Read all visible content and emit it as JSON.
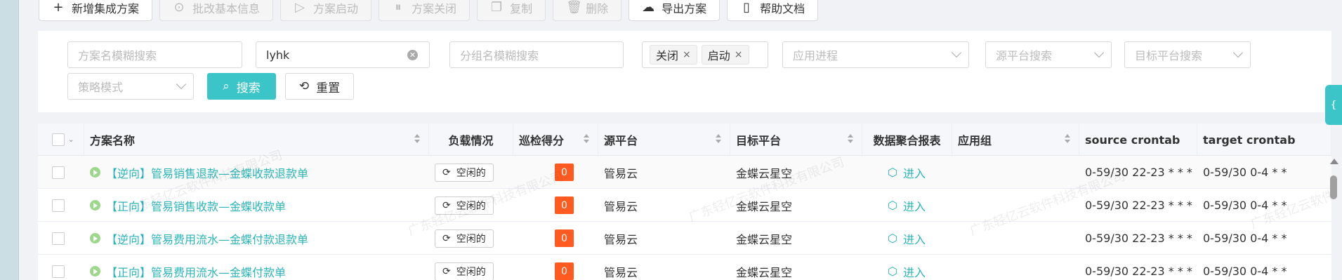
{
  "toolbar": {
    "buttons": [
      {
        "label": "新增集成方案",
        "icon": "plus-icon",
        "disabled": false
      },
      {
        "label": "批改基本信息",
        "icon": "check-circle-icon",
        "disabled": true
      },
      {
        "label": "方案启动",
        "icon": "play-circle-icon",
        "disabled": true
      },
      {
        "label": "方案关闭",
        "icon": "pause-circle-icon",
        "disabled": true
      },
      {
        "label": "复制",
        "icon": "copy-icon",
        "disabled": true
      },
      {
        "label": "删除",
        "icon": "trash-icon",
        "disabled": true
      },
      {
        "label": "导出方案",
        "icon": "cloud-download-icon",
        "disabled": false
      },
      {
        "label": "帮助文档",
        "icon": "document-icon",
        "disabled": false
      }
    ]
  },
  "filters": {
    "scheme_name_placeholder": "方案名模糊搜索",
    "keyword_value": "lyhk",
    "group_name_placeholder": "分组名模糊搜索",
    "status_tags": [
      "关闭",
      "启动"
    ],
    "app_process_placeholder": "应用进程",
    "source_platform_placeholder": "源平台搜索",
    "target_platform_placeholder": "目标平台搜索",
    "strategy_placeholder": "策略模式",
    "search_label": "搜索",
    "reset_label": "重置"
  },
  "table": {
    "columns": [
      "方案名称",
      "负载情况",
      "巡检得分",
      "源平台",
      "目标平台",
      "数据聚合报表",
      "应用组",
      "source crontab",
      "target crontab"
    ],
    "rows": [
      {
        "name": "【逆向】管易销售退款—金蝶收款退款单",
        "load": "空闲的",
        "score": "0",
        "source": "管易云",
        "target": "金蝶云星空",
        "report": "进入",
        "group": "",
        "source_cron": "0-59/30 22-23 * * *",
        "target_cron": "0-59/30 0-4 * *"
      },
      {
        "name": "【正向】管易销售收款—金蝶收款单",
        "load": "空闲的",
        "score": "0",
        "source": "管易云",
        "target": "金蝶云星空",
        "report": "进入",
        "group": "",
        "source_cron": "0-59/30 22-23 * * *",
        "target_cron": "0-59/30 0-4 * *"
      },
      {
        "name": "【逆向】管易费用流水—金蝶付款退款单",
        "load": "空闲的",
        "score": "0",
        "source": "管易云",
        "target": "金蝶云星空",
        "report": "进入",
        "group": "",
        "source_cron": "0-59/30 22-23 * * *",
        "target_cron": "0-59/30 0-4 * *"
      },
      {
        "name": "【正向】管易费用流水—金蝶付款单",
        "load": "空闲的",
        "score": "0",
        "source": "管易云",
        "target": "金蝶云星空",
        "report": "进入",
        "group": "",
        "source_cron": "0-59/30 22-23 * * *",
        "target_cron": "0-59/30 0-4 * *"
      }
    ]
  },
  "watermark": "广东轻亿云软件科技有限公司",
  "colors": {
    "accent": "#3cc5c8",
    "link": "#2bb5b8",
    "score_bg": "#ff5a1f"
  }
}
